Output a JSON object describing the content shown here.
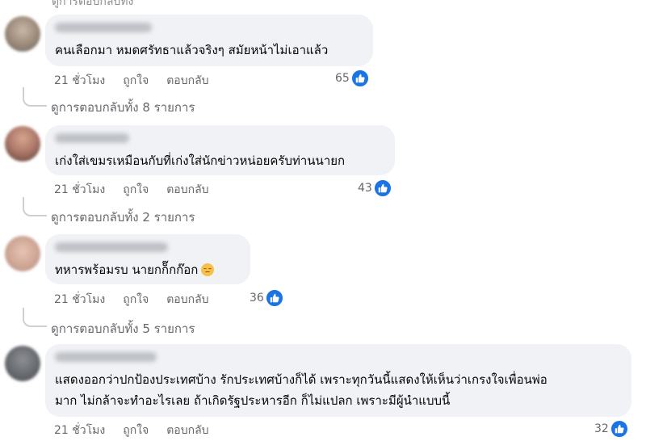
{
  "top_cut_text": "ดูการตอบกลับทั้ง",
  "comments": [
    {
      "text": "คนเลือกมา หมดศรัทธาแล้วจริงๆ สมัยหน้าไม่เอาแล้ว",
      "time": "21 ชั่วโมง",
      "like_label": "ถูกใจ",
      "reply_label": "ตอบกลับ",
      "reactions": "65",
      "view_replies": "ดูการตอบกลับทั้ง 8 รายการ"
    },
    {
      "text": "เก่งใส่เขมรเหมือนกับที่เก่งใส่นักข่าวหน่อยครับท่านนายก",
      "time": "21 ชั่วโมง",
      "like_label": "ถูกใจ",
      "reply_label": "ตอบกลับ",
      "reactions": "43",
      "view_replies": "ดูการตอบกลับทั้ง 2 รายการ"
    },
    {
      "text": "ทหารพร้อมรบ นายกก็๊กก๊อก",
      "emoji": "relieved-face-emoji",
      "time": "21 ชั่วโมง",
      "like_label": "ถูกใจ",
      "reply_label": "ตอบกลับ",
      "reactions": "36",
      "view_replies": "ดูการตอบกลับทั้ง 5 รายการ"
    },
    {
      "text": "แสดงออกว่าปกป้องประเทศบ้าง รักประเทศบ้างก็ได้ เพราะทุกวันนี้แสดงให้เห็นว่าเกรงใจเพื่อนพ่อ\nมาก ไม่กล้าจะทำอะไรเลย ถ้าเกิดรัฐประหารอีก ก็ไม่แปลก เพราะมีผู้นำแบบนี้",
      "time": "21 ชั่วโมง",
      "like_label": "ถูกใจ",
      "reply_label": "ตอบกลับ",
      "reactions": "32"
    }
  ],
  "colors": {
    "bubble": "#f0f2f5",
    "like_blue": "#1b74e4",
    "meta_text": "#65676b"
  },
  "icons": {
    "reaction": "like-thumbs-up-icon"
  }
}
